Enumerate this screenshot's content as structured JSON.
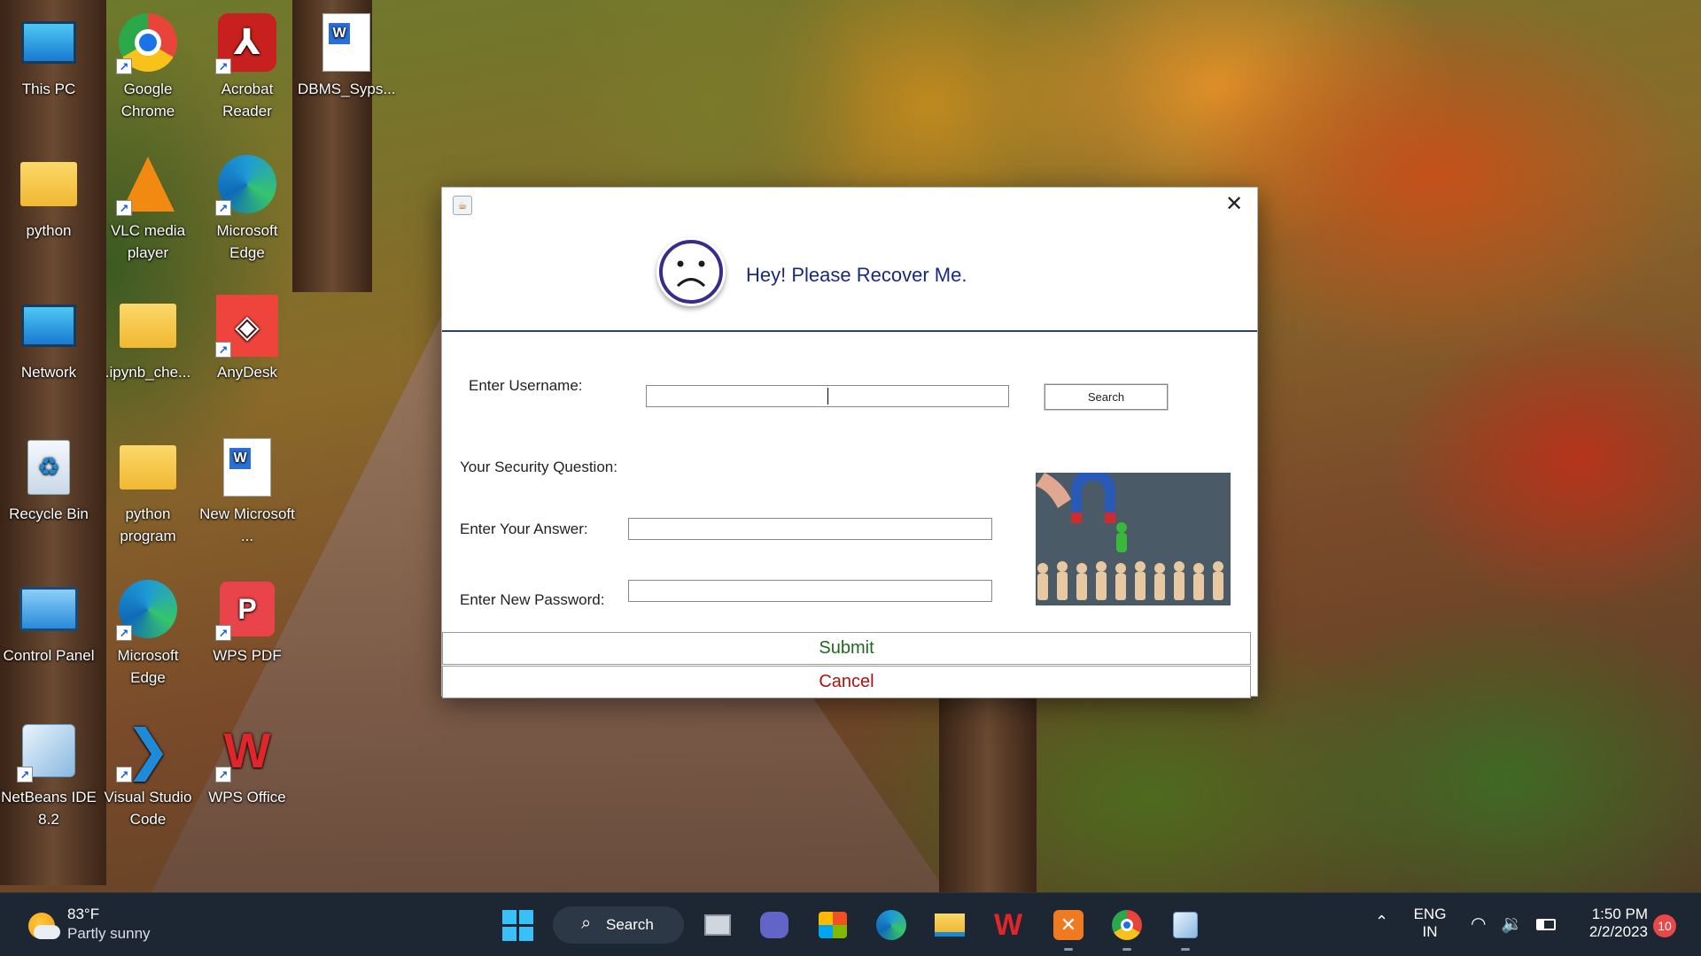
{
  "desktop": {
    "icons": [
      {
        "label": "This PC",
        "icon": "monitor-icon",
        "color": "#2aa0e0"
      },
      {
        "label": "Google Chrome",
        "icon": "chrome-icon",
        "color": "#e8443a"
      },
      {
        "label": "Acrobat Reader",
        "icon": "acrobat-icon",
        "color": "#c8201e"
      },
      {
        "label": "DBMS_Syps...",
        "icon": "word-doc-icon",
        "color": "#ffffff"
      },
      {
        "label": "python",
        "icon": "folder-icon",
        "color": "#f5c842"
      },
      {
        "label": "VLC media player",
        "icon": "vlc-icon",
        "color": "#f28a12"
      },
      {
        "label": "Microsoft Edge",
        "icon": "edge-icon",
        "color": "#1f9ad6"
      },
      {
        "label": "Network",
        "icon": "network-icon",
        "color": "#2aa0e0"
      },
      {
        "label": ".ipynb_che...",
        "icon": "folder-icon",
        "color": "#f5c842"
      },
      {
        "label": "AnyDesk",
        "icon": "anydesk-icon",
        "color": "#ef443b"
      },
      {
        "label": "Recycle Bin",
        "icon": "recycle-bin-icon",
        "color": "#e8f0f8"
      },
      {
        "label": "python program",
        "icon": "folder-icon",
        "color": "#f5c842"
      },
      {
        "label": "New Microsoft ...",
        "icon": "word-doc-icon",
        "color": "#ffffff"
      },
      {
        "label": "Control Panel",
        "icon": "control-panel-icon",
        "color": "#3aa0e8"
      },
      {
        "label": "Microsoft Edge",
        "icon": "edge-icon",
        "color": "#1f9ad6"
      },
      {
        "label": "WPS PDF",
        "icon": "wps-pdf-icon",
        "color": "#e8444a"
      },
      {
        "label": "NetBeans IDE 8.2",
        "icon": "netbeans-icon",
        "color": "#b8d8f0"
      },
      {
        "label": "Visual Studio Code",
        "icon": "vscode-icon",
        "color": "#1f8ad8"
      },
      {
        "label": "WPS Office",
        "icon": "wps-office-icon",
        "color": "#e0262a"
      }
    ]
  },
  "dialog": {
    "heading": "Hey! Please Recover Me.",
    "username_label": "Enter Username:",
    "username_value": "",
    "search_label": "Search",
    "security_question_label": "Your Security Question:",
    "answer_label": "Enter Your Answer:",
    "answer_value": "",
    "new_password_label": "Enter New Password:",
    "new_password_value": "",
    "submit_label": "Submit",
    "cancel_label": "Cancel",
    "close_glyph": "✕",
    "colors": {
      "heading": "#1a2a7a",
      "submit": "#1e6a1e",
      "cancel": "#b01010"
    }
  },
  "taskbar": {
    "weather_temp": "83°F",
    "weather_desc": "Partly sunny",
    "search_label": "Search",
    "language": "ENG",
    "region": "IN",
    "time": "1:50 PM",
    "date": "2/2/2023",
    "notification_count": "10",
    "apps": [
      "windows-start-icon",
      "task-view-icon",
      "teams-chat-icon",
      "microsoft-store-icon",
      "edge-icon",
      "file-explorer-icon",
      "wps-office-icon",
      "xampp-icon",
      "chrome-icon",
      "netbeans-icon"
    ]
  }
}
